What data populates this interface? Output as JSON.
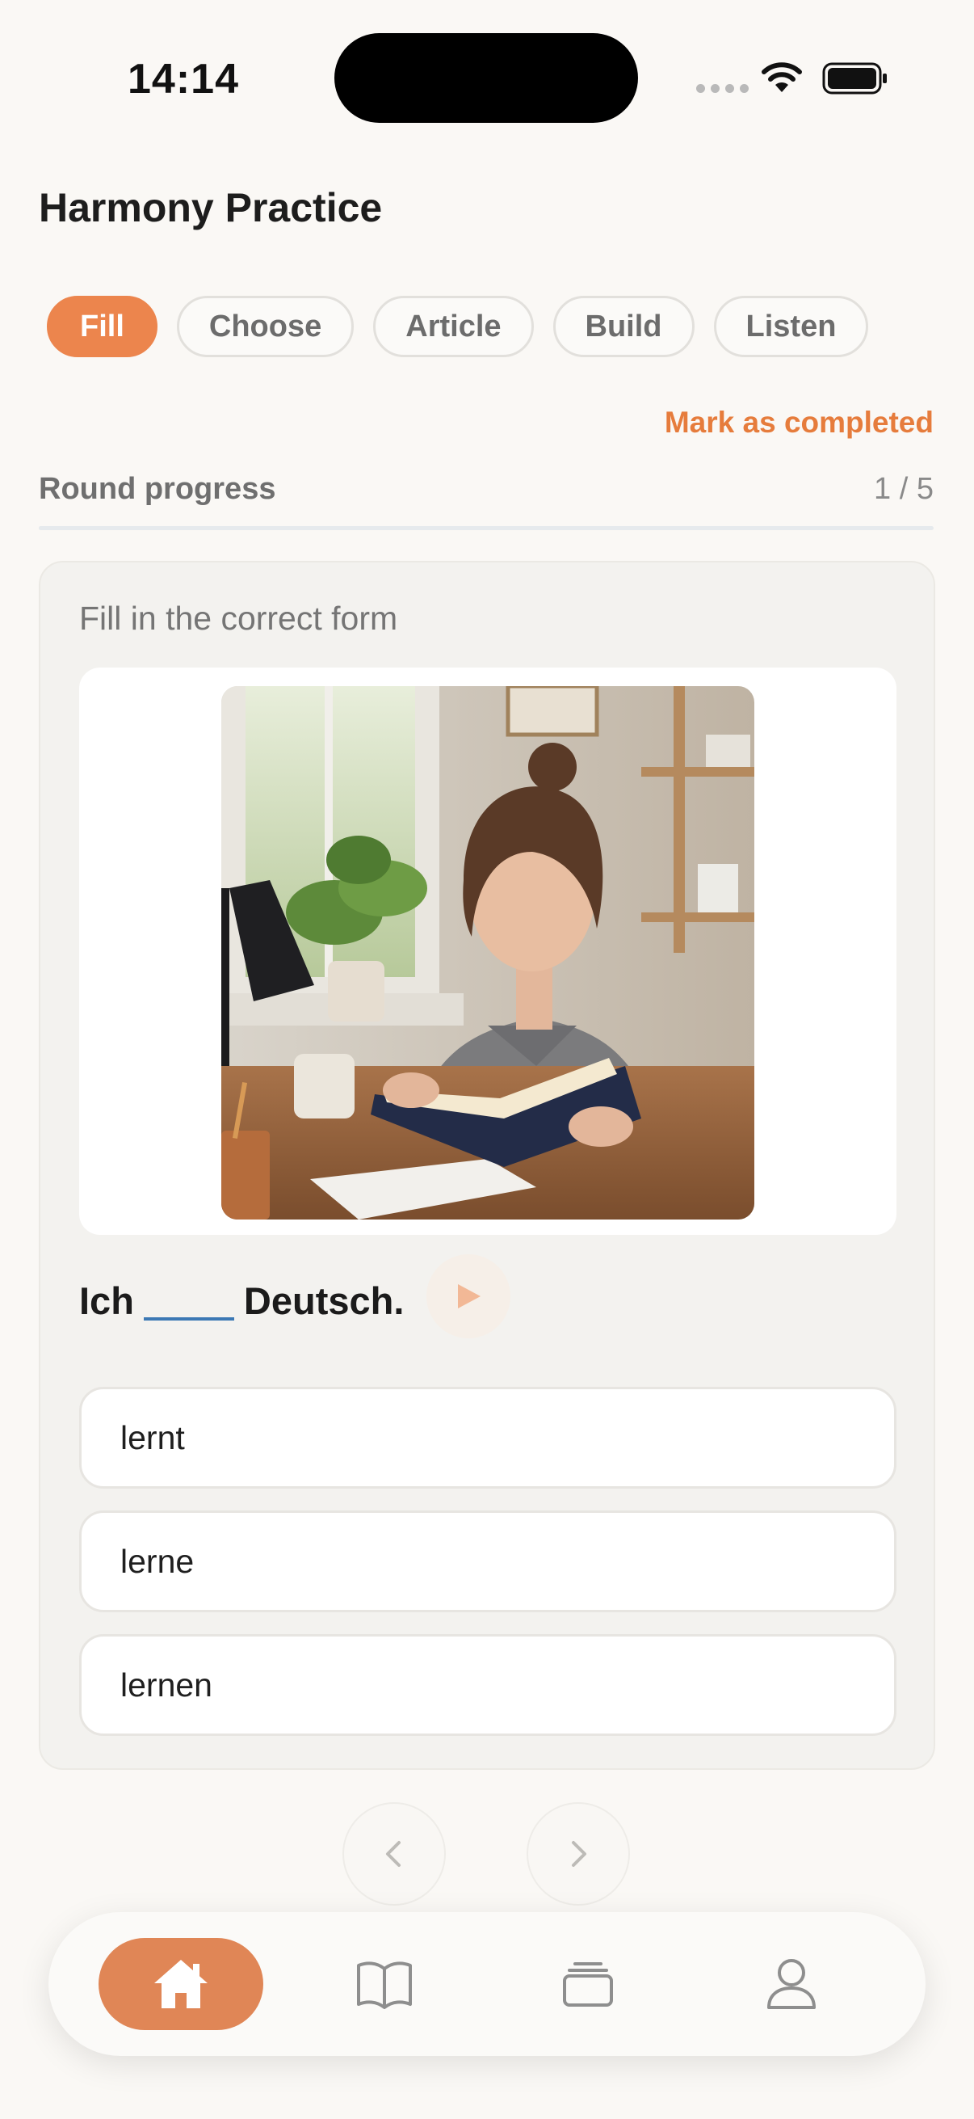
{
  "status_bar": {
    "time": "14:14"
  },
  "header": {
    "title": "Harmony Practice"
  },
  "tabs": [
    {
      "label": "Fill",
      "active": true
    },
    {
      "label": "Choose",
      "active": false
    },
    {
      "label": "Article",
      "active": false
    },
    {
      "label": "Build",
      "active": false
    },
    {
      "label": "Listen",
      "active": false
    }
  ],
  "mark_completed_label": "Mark as completed",
  "progress": {
    "label": "Round progress",
    "count_text": "1 / 5",
    "value": 0.2
  },
  "exercise": {
    "instruction": "Fill in the correct form",
    "sentence_before": "Ich",
    "sentence_after": "Deutsch.",
    "options": [
      "lernt",
      "lerne",
      "lernen"
    ]
  },
  "bottom_nav": [
    {
      "icon": "home-icon",
      "active": true
    },
    {
      "icon": "book-icon",
      "active": false
    },
    {
      "icon": "cards-icon",
      "active": false
    },
    {
      "icon": "profile-icon",
      "active": false
    }
  ],
  "colors": {
    "accent": "#ec854d",
    "blank": "#3b78b4",
    "background": "#faf8f5"
  }
}
